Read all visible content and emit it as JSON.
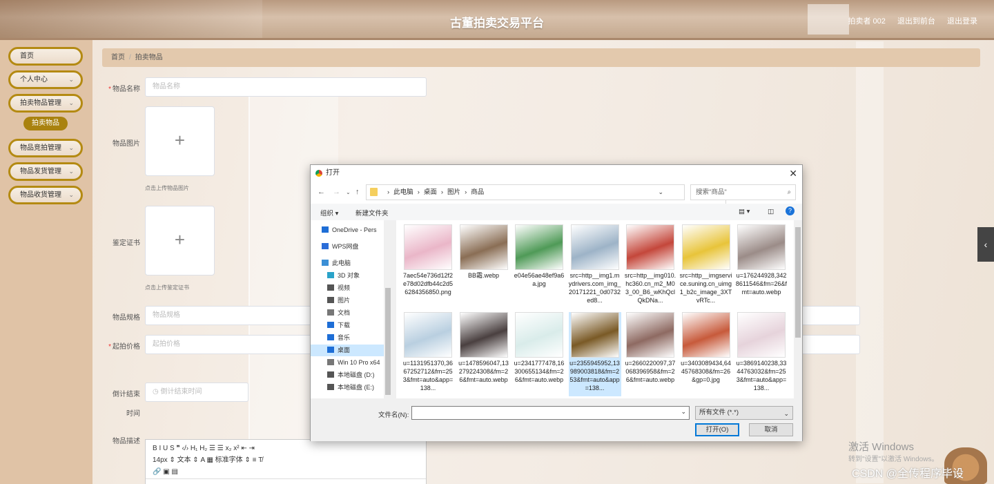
{
  "app": {
    "title": "古董拍卖交易平台",
    "user": "拍卖者 002",
    "back_link": "退出到前台",
    "logout": "退出登录"
  },
  "sidebar": {
    "items": [
      {
        "label": "首页"
      },
      {
        "label": "个人中心",
        "chevron": "⌄"
      },
      {
        "label": "拍卖物品管理",
        "chevron": "⌄"
      },
      {
        "label": "物品竞拍管理",
        "chevron": "⌄"
      },
      {
        "label": "物品发货管理",
        "chevron": "⌄"
      },
      {
        "label": "物品收货管理",
        "chevron": "⌄"
      }
    ],
    "sub_item": "拍卖物品"
  },
  "breadcrumb": {
    "home": "首页",
    "sep": "/",
    "current": "拍卖物品"
  },
  "form": {
    "name_label": "物品名称",
    "name_placeholder": "物品名称",
    "image_label": "物品图片",
    "image_tip": "点击上传物品图片",
    "cert_label": "鉴定证书",
    "cert_tip": "点击上传鉴定证书",
    "spec_label": "物品规格",
    "spec_placeholder": "物品规格",
    "price_label": "起拍价格",
    "price_placeholder": "起拍价格",
    "countdown_label": "倒计结束",
    "countdown_label2": "时间",
    "countdown_placeholder": "◷ 倒计结束时间",
    "desc_label": "物品描述",
    "required_mark": "*",
    "upload_plus": "+"
  },
  "editor": {
    "row1": "B  I  U  S    ❞  ‹/›   H₁  H₂   ☰  ☰    x₂  x²   ⇤  ⇥",
    "row2": "14px   ⇕    文本   ⇕   A  ▦   标准字体   ⇕   ≡   T̸",
    "row3": "🔗  ▣  ▤"
  },
  "dialog": {
    "title": "打开",
    "close": "✕",
    "path": [
      "此电脑",
      "桌面",
      "图片",
      "商品"
    ],
    "path_sep": "›",
    "search_placeholder": "搜索\"商品\"",
    "organize": "组织 ▾",
    "new_folder": "新建文件夹",
    "nav_items": [
      {
        "label": "OneDrive - Pers",
        "icon": "cloud-icon",
        "color": "#1e6ed6"
      },
      {
        "label": "WPS网盘",
        "icon": "cloud-icon",
        "color": "#2b6dd8"
      },
      {
        "label": "此电脑",
        "icon": "pc-icon",
        "color": "#3b8fd6"
      },
      {
        "label": "3D 对象",
        "icon": "cube-icon",
        "color": "#2aa3c9"
      },
      {
        "label": "视频",
        "icon": "video-icon",
        "color": "#555"
      },
      {
        "label": "图片",
        "icon": "picture-icon",
        "color": "#555"
      },
      {
        "label": "文档",
        "icon": "document-icon",
        "color": "#777"
      },
      {
        "label": "下载",
        "icon": "download-icon",
        "color": "#1e6ed6"
      },
      {
        "label": "音乐",
        "icon": "music-icon",
        "color": "#1e6ed6"
      },
      {
        "label": "桌面",
        "icon": "desktop-icon",
        "color": "#1e6ed6"
      },
      {
        "label": "Win 10 Pro x64",
        "icon": "drive-icon",
        "color": "#777"
      },
      {
        "label": "本地磁盘 (D:)",
        "icon": "drive-icon",
        "color": "#555"
      },
      {
        "label": "本地磁盘 (E:)",
        "icon": "drive-icon",
        "color": "#555"
      }
    ],
    "files": [
      {
        "name": "7aec54e736d12f2e78d02dfb44c2d56284356850.png",
        "thumb": "#eab6c8"
      },
      {
        "name": "BB霜.webp",
        "thumb": "#8a6e55"
      },
      {
        "name": "e04e56ae48ef9a6a.jpg",
        "thumb": "#4f9a57"
      },
      {
        "name": "src=http__img1.mydrivers.com_img_20171221_0d0732ed8...",
        "thumb": "#9db3c7"
      },
      {
        "name": "src=http__img010.hc360.cn_m2_M03_00_B6_wKhQclQkDNa...",
        "thumb": "#c4473b"
      },
      {
        "name": "src=http__imgservice.suning.cn_uimg1_b2c_image_3XTvRTc...",
        "thumb": "#e8c43a"
      },
      {
        "name": "u=176244928,3428611546&fm=26&fmt=auto.webp",
        "thumb": "#9b8c88"
      },
      {
        "name": "u=1131951370,3667252712&fm=253&fmt=auto&app=138...",
        "thumb": "#b9cfe0"
      },
      {
        "name": "u=1478596047,13279224308&fm=26&fmt=auto.webp",
        "thumb": "#4a4040"
      },
      {
        "name": "u=2341777478,16300655134&fm=26&fmt=auto.webp",
        "thumb": "#d9ecea"
      },
      {
        "name": "u=2355945952,13989003818&fm=253&fmt=auto&app=138...",
        "thumb": "#7a5a26"
      },
      {
        "name": "u=2660220097,37068396958&fm=26&fmt=auto.webp",
        "thumb": "#8e6a62"
      },
      {
        "name": "u=3403089434,6445768308&fm=26&gp=0.jpg",
        "thumb": "#c75a3b"
      },
      {
        "name": "u=3869140238,3344763032&fm=253&fmt=auto&app=138...",
        "thumb": "#e6d3db"
      }
    ],
    "selected_file_index": 10,
    "filename_label": "文件名(N):",
    "filename_value": "",
    "filetype": "所有文件 (*.*)",
    "open_button": "打开(O)",
    "cancel_button": "取消"
  },
  "overlay": {
    "activate_title": "激活 Windows",
    "activate_sub": "转到\"设置\"以激活 Windows。",
    "csdn": "CSDN @全传程序毕设",
    "side_tab": "‹"
  }
}
